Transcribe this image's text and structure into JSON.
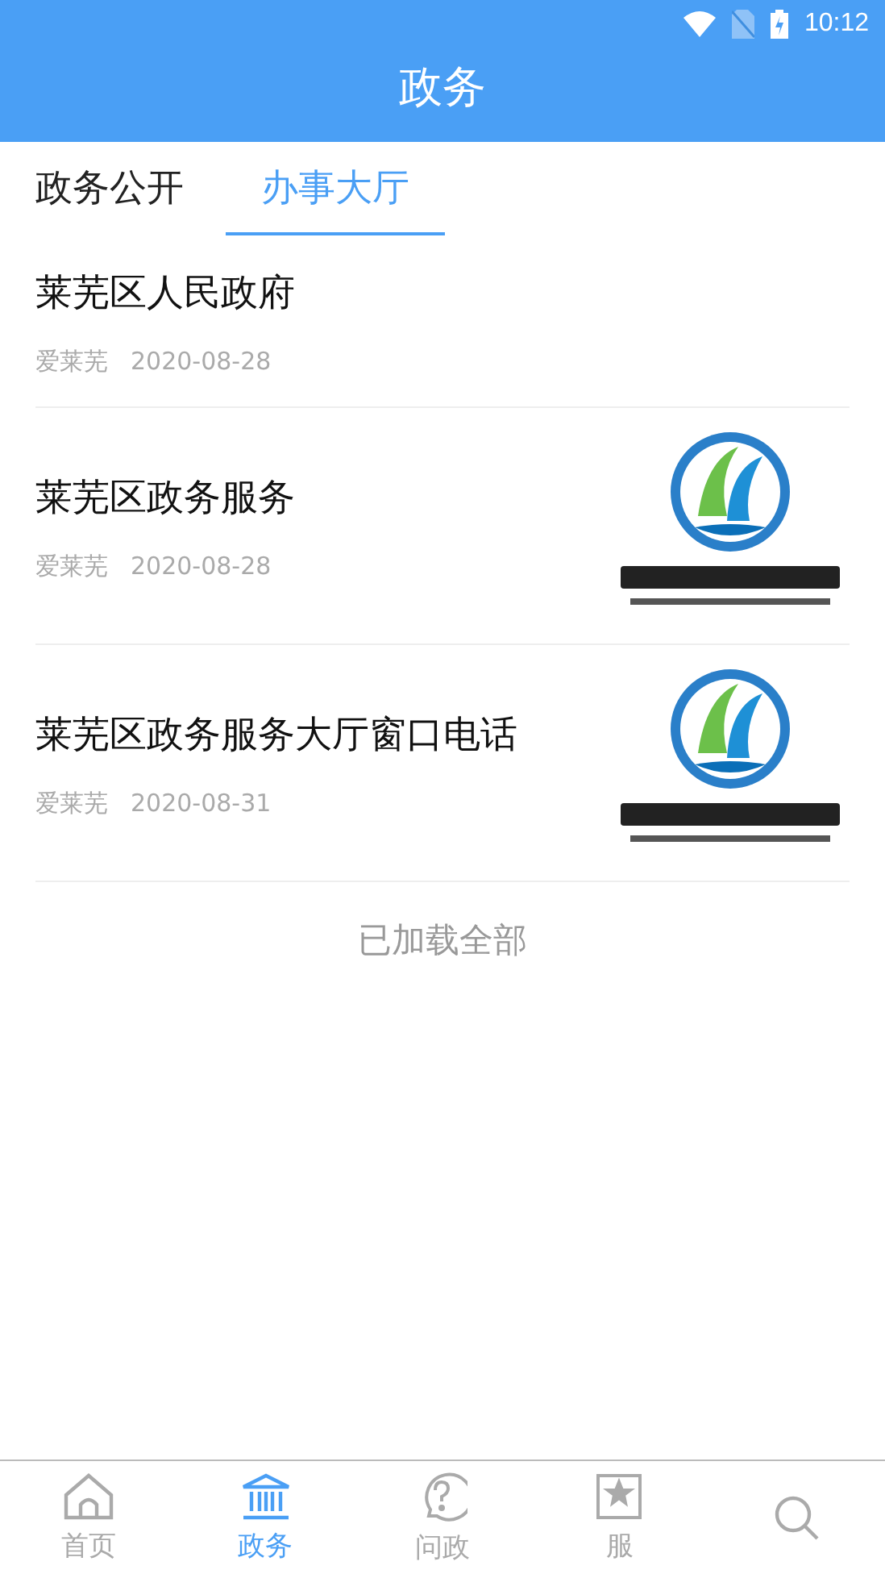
{
  "status_bar": {
    "time": "10:12"
  },
  "header": {
    "title": "政务"
  },
  "tabs": [
    {
      "label": "政务公开",
      "selected": false
    },
    {
      "label": "办事大厅",
      "selected": true
    }
  ],
  "articles": [
    {
      "title": "莱芜区人民政府",
      "source": "爱莱芜",
      "date": "2020-08-28"
    },
    {
      "title": "莱芜区政务服务",
      "source": "爱莱芜",
      "date": "2020-08-28"
    },
    {
      "title": "莱芜区政务服务大厅窗口电话",
      "source": "爱莱芜",
      "date": "2020-08-31"
    }
  ],
  "footer_note": "已加载全部",
  "bottom_nav": [
    {
      "kind": "home",
      "label": "首页",
      "selected": false
    },
    {
      "kind": "bank",
      "label": "政务",
      "selected": true
    },
    {
      "kind": "question",
      "label": "问政",
      "selected": false
    },
    {
      "kind": "star",
      "label": "服",
      "selected": false
    },
    {
      "kind": "search",
      "selected": false
    }
  ]
}
